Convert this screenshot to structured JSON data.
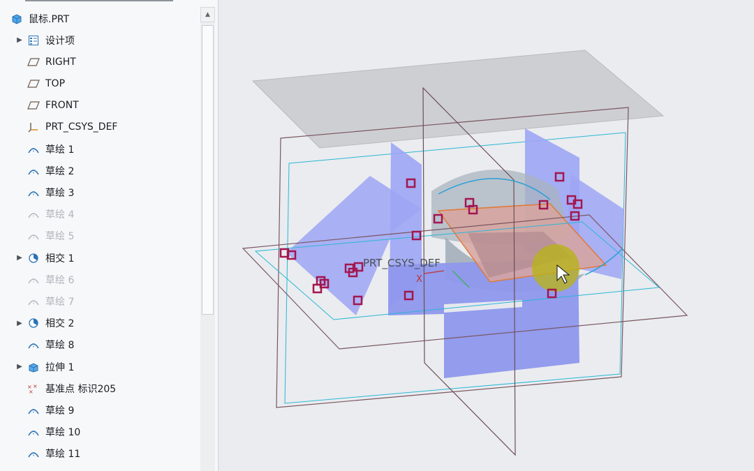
{
  "model_tree": {
    "root": "鼠标.PRT",
    "items": [
      {
        "label": "设计项",
        "icon": "layers-icon",
        "expandable": true,
        "suppressed": false
      },
      {
        "label": "RIGHT",
        "icon": "datum-plane-icon",
        "expandable": false,
        "suppressed": false
      },
      {
        "label": "TOP",
        "icon": "datum-plane-icon",
        "expandable": false,
        "suppressed": false
      },
      {
        "label": "FRONT",
        "icon": "datum-plane-icon",
        "expandable": false,
        "suppressed": false
      },
      {
        "label": "PRT_CSYS_DEF",
        "icon": "csys-icon",
        "expandable": false,
        "suppressed": false
      },
      {
        "label": "草绘 1",
        "icon": "sketch-icon",
        "expandable": false,
        "suppressed": false
      },
      {
        "label": "草绘 2",
        "icon": "sketch-icon",
        "expandable": false,
        "suppressed": false
      },
      {
        "label": "草绘 3",
        "icon": "sketch-icon",
        "expandable": false,
        "suppressed": false
      },
      {
        "label": "草绘 4",
        "icon": "sketch-icon",
        "expandable": false,
        "suppressed": true
      },
      {
        "label": "草绘 5",
        "icon": "sketch-icon",
        "expandable": false,
        "suppressed": true
      },
      {
        "label": "相交 1",
        "icon": "intersect-icon",
        "expandable": true,
        "suppressed": false
      },
      {
        "label": "草绘 6",
        "icon": "sketch-icon",
        "expandable": false,
        "suppressed": true
      },
      {
        "label": "草绘 7",
        "icon": "sketch-icon",
        "expandable": false,
        "suppressed": true
      },
      {
        "label": "相交 2",
        "icon": "intersect-icon",
        "expandable": true,
        "suppressed": false
      },
      {
        "label": "草绘 8",
        "icon": "sketch-icon",
        "expandable": false,
        "suppressed": false
      },
      {
        "label": "拉伸 1",
        "icon": "extrude-icon",
        "expandable": true,
        "suppressed": false
      },
      {
        "label": "基准点 标识205",
        "icon": "datum-point-icon",
        "expandable": false,
        "suppressed": false
      },
      {
        "label": "草绘 9",
        "icon": "sketch-icon",
        "expandable": false,
        "suppressed": false
      },
      {
        "label": "草绘 10",
        "icon": "sketch-icon",
        "expandable": false,
        "suppressed": false
      },
      {
        "label": "草绘 11",
        "icon": "sketch-icon",
        "expandable": false,
        "suppressed": false
      }
    ]
  },
  "viewport": {
    "csys_label": "PRT_CSYS_DEF",
    "csys_axis_x": "X",
    "colors": {
      "surface": "#9da6f4",
      "datum_plane_edge": "#7a5560",
      "datum_plane_fill": "#c9cacd",
      "sketch_cyan": "#2ab7d6",
      "handle": "#a3164f",
      "highlight_plane": "#d8a49e",
      "orange_edge": "#e07a3a"
    }
  }
}
